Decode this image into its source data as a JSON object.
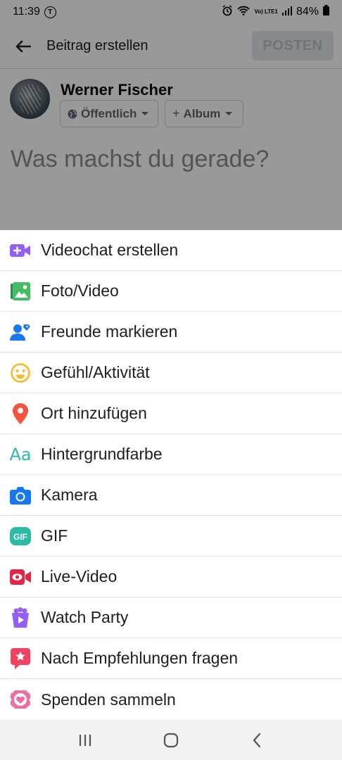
{
  "status_bar": {
    "time": "11:39",
    "carrier_icon_letter": "T",
    "lte_label": "Vo) LTE1",
    "battery": "84%"
  },
  "header": {
    "title": "Beitrag erstellen",
    "post_label": "POSTEN"
  },
  "user": {
    "name": "Werner Fischer",
    "audience_label": "Öffentlich",
    "album_label": "Album"
  },
  "composer": {
    "placeholder": "Was machst du gerade?"
  },
  "options": [
    {
      "label": "Videochat erstellen",
      "icon": "video-plus-icon",
      "color": "#9360f7"
    },
    {
      "label": "Foto/Video",
      "icon": "photo-icon",
      "color": "#45bd62"
    },
    {
      "label": "Freunde markieren",
      "icon": "tag-friends-icon",
      "color": "#1877f2"
    },
    {
      "label": "Gefühl/Aktivität",
      "icon": "smiley-icon",
      "color": "#f7b928"
    },
    {
      "label": "Ort hinzufügen",
      "icon": "location-pin-icon",
      "color": "#f5533d"
    },
    {
      "label": "Hintergrundfarbe",
      "icon": "text-aa-icon",
      "color": "#2abba7"
    },
    {
      "label": "Kamera",
      "icon": "camera-icon",
      "color": "#1877f2"
    },
    {
      "label": "GIF",
      "icon": "gif-icon",
      "color": "#2abba7"
    },
    {
      "label": "Live-Video",
      "icon": "live-video-icon",
      "color": "#e42645"
    },
    {
      "label": "Watch Party",
      "icon": "watch-party-icon",
      "color": "#9360f7"
    },
    {
      "label": "Nach Empfehlungen fragen",
      "icon": "recommendation-icon",
      "color": "#f3425f"
    },
    {
      "label": "Spenden sammeln",
      "icon": "fundraiser-icon",
      "color": "#ec6ea5"
    }
  ],
  "nav": {
    "recents": "recents-icon",
    "home": "home-icon",
    "back": "back-icon"
  }
}
